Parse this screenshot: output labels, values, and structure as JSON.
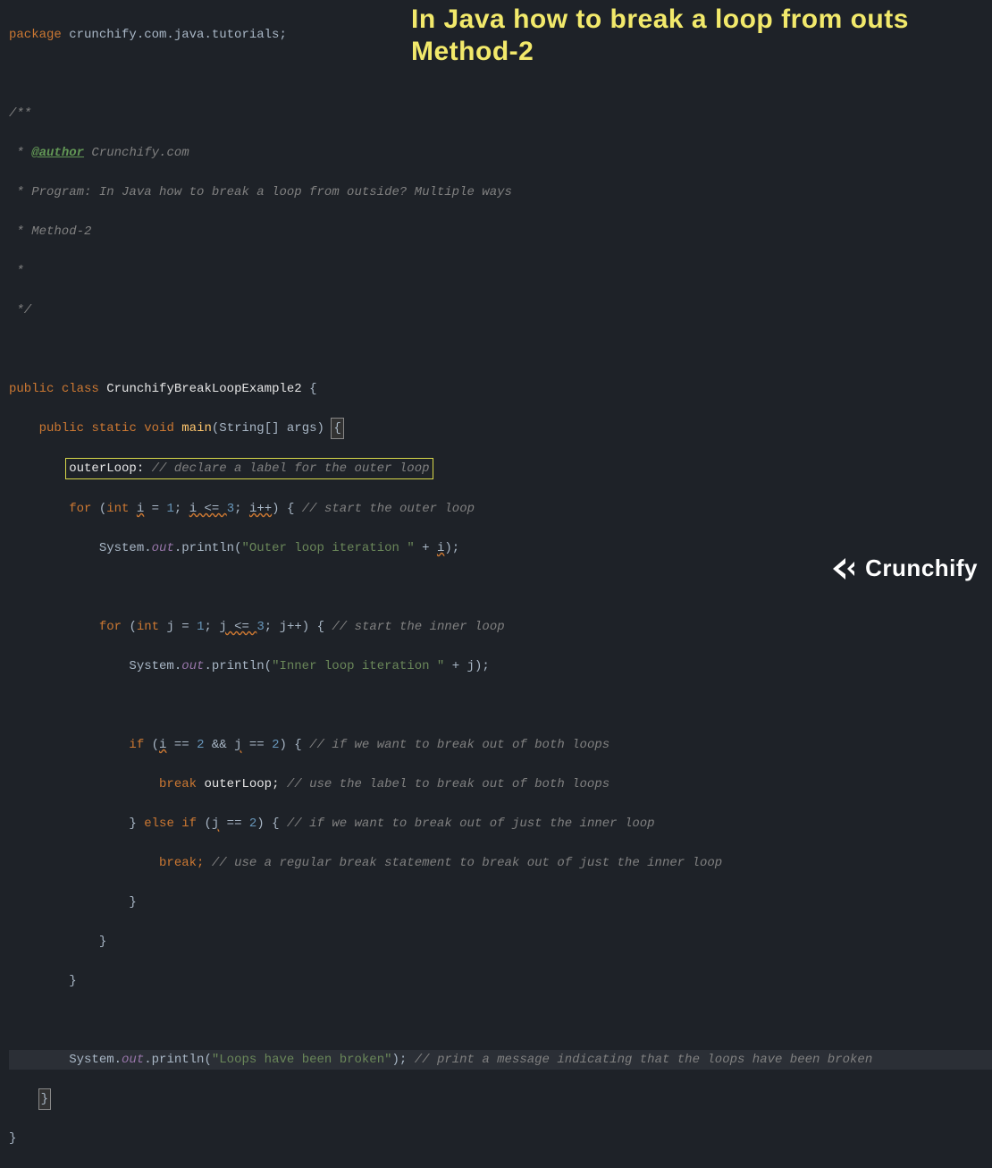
{
  "overlay": {
    "title_line1": "In Java how to break a loop from outs",
    "title_line2": "Method-2"
  },
  "logo": {
    "text": "Crunchify"
  },
  "code": {
    "pkg_kw": "package",
    "pkg_path": "crunchify.com.java.tutorials",
    "c1": "/**",
    "c2a": " * ",
    "c2tag": "@author",
    "c2b": " Crunchify.com",
    "c3": " * Program: In Java how to break a loop from outside? Multiple ways",
    "c4": " * Method-2",
    "c5": " *",
    "c6": " */",
    "public": "public",
    "class": "class",
    "className": "CrunchifyBreakLoopExample2",
    "static": "static",
    "void": "void",
    "main": "main",
    "mainArgs": "String[] args",
    "label": "outerLoop:",
    "labelComment": "// declare a label for the outer loop",
    "for": "for",
    "int": "int",
    "i": "i",
    "eq": " = ",
    "one": "1",
    "semi": "; ",
    "ile": "i <= ",
    "three": "3",
    "ipp": "i++",
    "outerComment": "// start the outer loop",
    "sys": "System.",
    "out": "out",
    "println": ".println(",
    "strOuter": "\"Outer loop iteration \"",
    "plus": " + ",
    "j": "j",
    "jle": "j <= ",
    "jpp": "j++",
    "innerComment": "// start the inner loop",
    "strInner": "\"Inner loop iteration \"",
    "if": "if",
    "eqeq": " == ",
    "two": "2",
    "and": " && ",
    "ifComment": "// if we want to break out of both loops",
    "break": "break",
    "breakLabel": "outerLoop;",
    "breakComment": "// use the label to break out of both loops",
    "else": "else",
    "elseIfComment": "// if we want to break out of just the inner loop",
    "breakSemi": "break;",
    "regBreakComment": "// use a regular break statement to break out of just the inner loop",
    "strBroken": "\"Loops have been broken\"",
    "brokenComment": "// print a message indicating that the loops have been broken"
  }
}
